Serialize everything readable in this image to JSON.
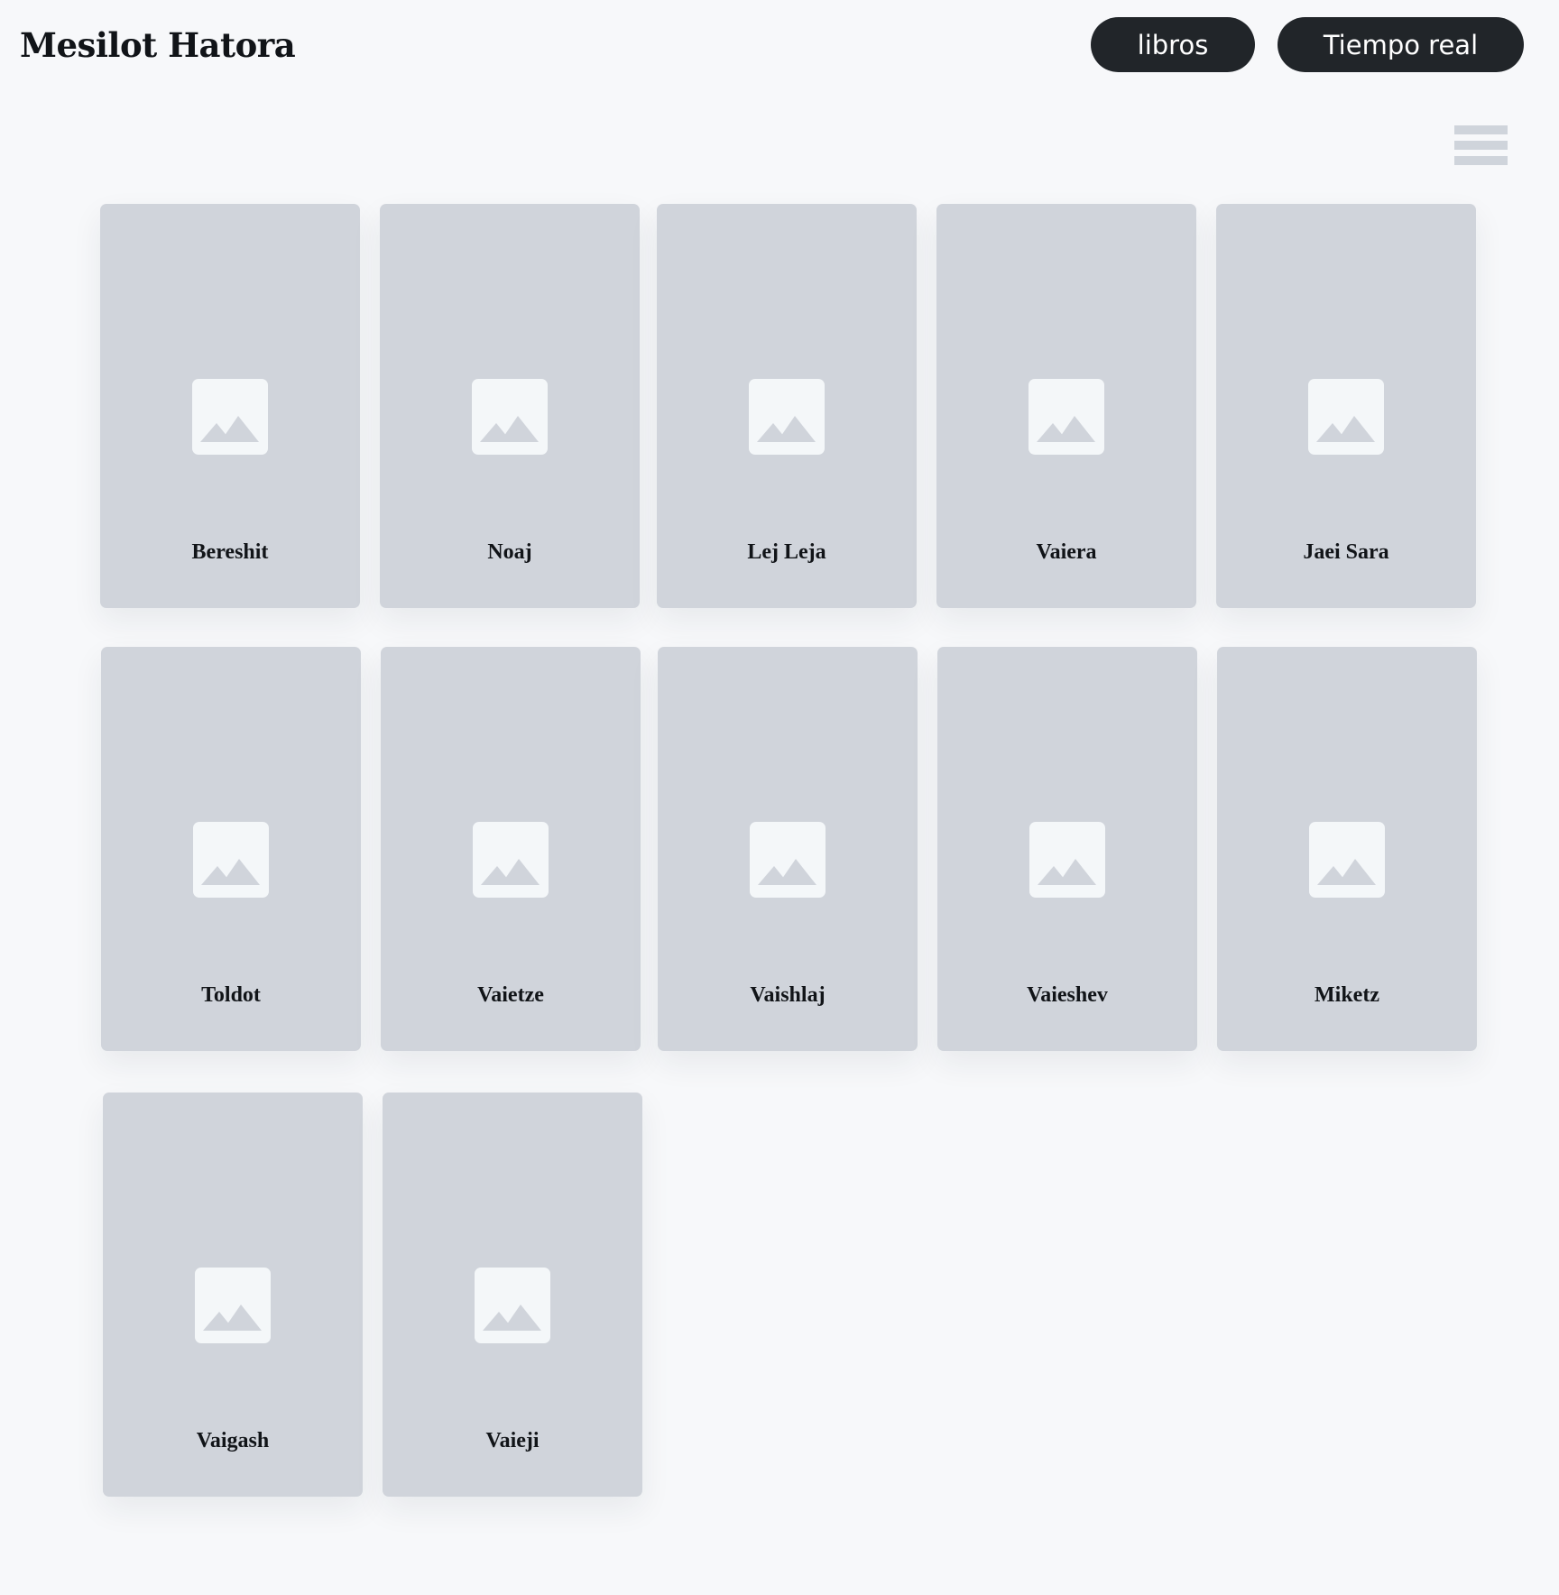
{
  "header": {
    "site_title": "Mesilot Hatora",
    "nav": {
      "libros_label": "libros",
      "tiempo_real_label": "Tiempo real"
    }
  },
  "menu_toggle": {
    "icon": "hamburger-menu-icon"
  },
  "cards": [
    {
      "label": "Bereshit",
      "icon": "image-placeholder-icon"
    },
    {
      "label": "Noaj",
      "icon": "image-placeholder-icon"
    },
    {
      "label": "Lej Leja",
      "icon": "image-placeholder-icon"
    },
    {
      "label": "Vaiera",
      "icon": "image-placeholder-icon"
    },
    {
      "label": "Jaei Sara",
      "icon": "image-placeholder-icon"
    },
    {
      "label": "Toldot",
      "icon": "image-placeholder-icon"
    },
    {
      "label": "Vaietze",
      "icon": "image-placeholder-icon"
    },
    {
      "label": "Vaishlaj",
      "icon": "image-placeholder-icon"
    },
    {
      "label": "Vaieshev",
      "icon": "image-placeholder-icon"
    },
    {
      "label": "Miketz",
      "icon": "image-placeholder-icon"
    },
    {
      "label": "Vaigash",
      "icon": "image-placeholder-icon"
    },
    {
      "label": "Vaieji",
      "icon": "image-placeholder-icon"
    }
  ],
  "colors": {
    "background": "#f7f8fa",
    "card": "#d0d4db",
    "button": "#212529",
    "placeholder": "#f4f7f9"
  }
}
